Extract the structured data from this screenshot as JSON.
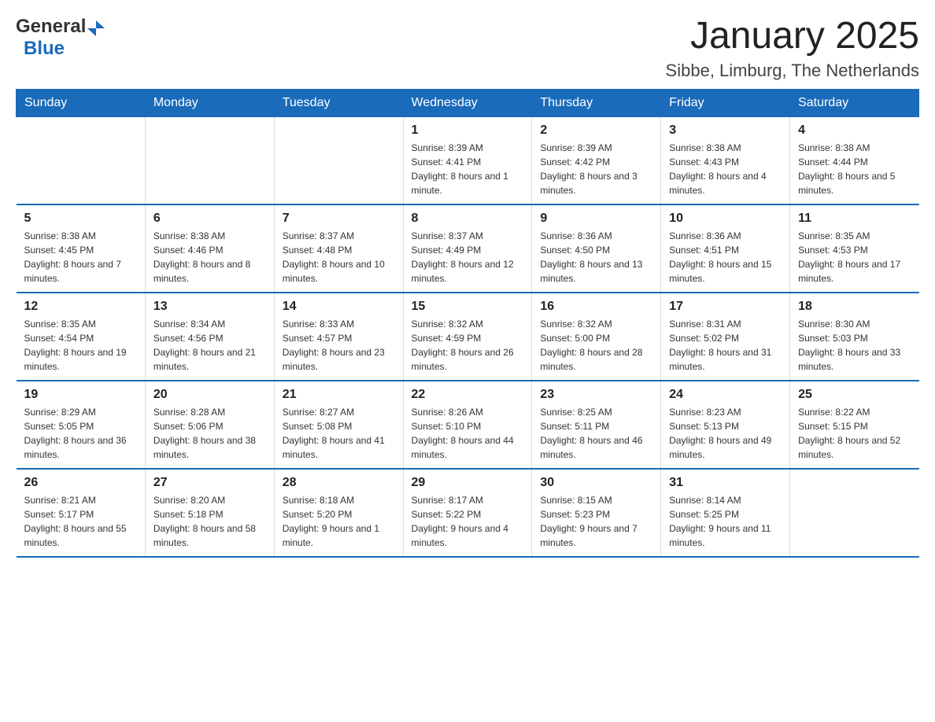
{
  "header": {
    "logo": {
      "text_general": "General",
      "text_blue": "Blue",
      "alt": "GeneralBlue Logo"
    },
    "title": "January 2025",
    "location": "Sibbe, Limburg, The Netherlands"
  },
  "calendar": {
    "days_of_week": [
      "Sunday",
      "Monday",
      "Tuesday",
      "Wednesday",
      "Thursday",
      "Friday",
      "Saturday"
    ],
    "weeks": [
      [
        {
          "day": "",
          "info": ""
        },
        {
          "day": "",
          "info": ""
        },
        {
          "day": "",
          "info": ""
        },
        {
          "day": "1",
          "info": "Sunrise: 8:39 AM\nSunset: 4:41 PM\nDaylight: 8 hours and 1 minute."
        },
        {
          "day": "2",
          "info": "Sunrise: 8:39 AM\nSunset: 4:42 PM\nDaylight: 8 hours and 3 minutes."
        },
        {
          "day": "3",
          "info": "Sunrise: 8:38 AM\nSunset: 4:43 PM\nDaylight: 8 hours and 4 minutes."
        },
        {
          "day": "4",
          "info": "Sunrise: 8:38 AM\nSunset: 4:44 PM\nDaylight: 8 hours and 5 minutes."
        }
      ],
      [
        {
          "day": "5",
          "info": "Sunrise: 8:38 AM\nSunset: 4:45 PM\nDaylight: 8 hours and 7 minutes."
        },
        {
          "day": "6",
          "info": "Sunrise: 8:38 AM\nSunset: 4:46 PM\nDaylight: 8 hours and 8 minutes."
        },
        {
          "day": "7",
          "info": "Sunrise: 8:37 AM\nSunset: 4:48 PM\nDaylight: 8 hours and 10 minutes."
        },
        {
          "day": "8",
          "info": "Sunrise: 8:37 AM\nSunset: 4:49 PM\nDaylight: 8 hours and 12 minutes."
        },
        {
          "day": "9",
          "info": "Sunrise: 8:36 AM\nSunset: 4:50 PM\nDaylight: 8 hours and 13 minutes."
        },
        {
          "day": "10",
          "info": "Sunrise: 8:36 AM\nSunset: 4:51 PM\nDaylight: 8 hours and 15 minutes."
        },
        {
          "day": "11",
          "info": "Sunrise: 8:35 AM\nSunset: 4:53 PM\nDaylight: 8 hours and 17 minutes."
        }
      ],
      [
        {
          "day": "12",
          "info": "Sunrise: 8:35 AM\nSunset: 4:54 PM\nDaylight: 8 hours and 19 minutes."
        },
        {
          "day": "13",
          "info": "Sunrise: 8:34 AM\nSunset: 4:56 PM\nDaylight: 8 hours and 21 minutes."
        },
        {
          "day": "14",
          "info": "Sunrise: 8:33 AM\nSunset: 4:57 PM\nDaylight: 8 hours and 23 minutes."
        },
        {
          "day": "15",
          "info": "Sunrise: 8:32 AM\nSunset: 4:59 PM\nDaylight: 8 hours and 26 minutes."
        },
        {
          "day": "16",
          "info": "Sunrise: 8:32 AM\nSunset: 5:00 PM\nDaylight: 8 hours and 28 minutes."
        },
        {
          "day": "17",
          "info": "Sunrise: 8:31 AM\nSunset: 5:02 PM\nDaylight: 8 hours and 31 minutes."
        },
        {
          "day": "18",
          "info": "Sunrise: 8:30 AM\nSunset: 5:03 PM\nDaylight: 8 hours and 33 minutes."
        }
      ],
      [
        {
          "day": "19",
          "info": "Sunrise: 8:29 AM\nSunset: 5:05 PM\nDaylight: 8 hours and 36 minutes."
        },
        {
          "day": "20",
          "info": "Sunrise: 8:28 AM\nSunset: 5:06 PM\nDaylight: 8 hours and 38 minutes."
        },
        {
          "day": "21",
          "info": "Sunrise: 8:27 AM\nSunset: 5:08 PM\nDaylight: 8 hours and 41 minutes."
        },
        {
          "day": "22",
          "info": "Sunrise: 8:26 AM\nSunset: 5:10 PM\nDaylight: 8 hours and 44 minutes."
        },
        {
          "day": "23",
          "info": "Sunrise: 8:25 AM\nSunset: 5:11 PM\nDaylight: 8 hours and 46 minutes."
        },
        {
          "day": "24",
          "info": "Sunrise: 8:23 AM\nSunset: 5:13 PM\nDaylight: 8 hours and 49 minutes."
        },
        {
          "day": "25",
          "info": "Sunrise: 8:22 AM\nSunset: 5:15 PM\nDaylight: 8 hours and 52 minutes."
        }
      ],
      [
        {
          "day": "26",
          "info": "Sunrise: 8:21 AM\nSunset: 5:17 PM\nDaylight: 8 hours and 55 minutes."
        },
        {
          "day": "27",
          "info": "Sunrise: 8:20 AM\nSunset: 5:18 PM\nDaylight: 8 hours and 58 minutes."
        },
        {
          "day": "28",
          "info": "Sunrise: 8:18 AM\nSunset: 5:20 PM\nDaylight: 9 hours and 1 minute."
        },
        {
          "day": "29",
          "info": "Sunrise: 8:17 AM\nSunset: 5:22 PM\nDaylight: 9 hours and 4 minutes."
        },
        {
          "day": "30",
          "info": "Sunrise: 8:15 AM\nSunset: 5:23 PM\nDaylight: 9 hours and 7 minutes."
        },
        {
          "day": "31",
          "info": "Sunrise: 8:14 AM\nSunset: 5:25 PM\nDaylight: 9 hours and 11 minutes."
        },
        {
          "day": "",
          "info": ""
        }
      ]
    ]
  }
}
